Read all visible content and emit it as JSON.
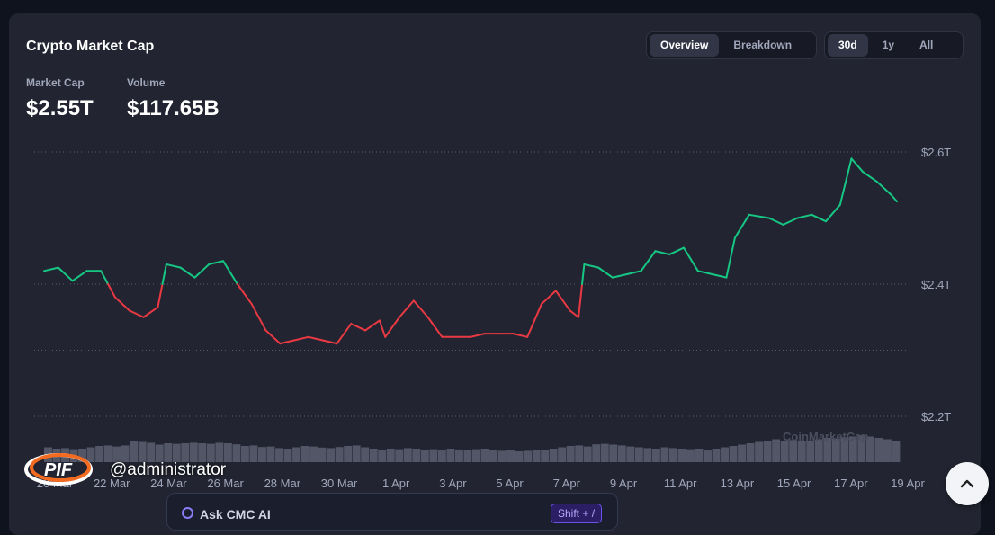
{
  "header": {
    "title": "Crypto Market Cap",
    "view_tabs": [
      {
        "label": "Overview",
        "active": true
      },
      {
        "label": "Breakdown",
        "active": false
      }
    ],
    "range_tabs": [
      {
        "label": "30d",
        "active": true
      },
      {
        "label": "1y",
        "active": false
      },
      {
        "label": "All",
        "active": false
      }
    ]
  },
  "metrics": {
    "market_cap_label": "Market Cap",
    "market_cap_value": "$2.55T",
    "volume_label": "Volume",
    "volume_value": "$117.65B"
  },
  "watermark": "CoinMarketCap",
  "ask": {
    "label": "Ask CMC AI",
    "shortcut": "Shift + /"
  },
  "overlay": {
    "user": "@administrator"
  },
  "colors": {
    "up": "#16c784",
    "down": "#ea3943",
    "grid": "#585d6e",
    "volume": "#5a5f70"
  },
  "chart_data": {
    "type": "line",
    "x_tick_labels": [
      "20 Mar",
      "22 Mar",
      "24 Mar",
      "26 Mar",
      "28 Mar",
      "30 Mar",
      "1 Apr",
      "3 Apr",
      "5 Apr",
      "7 Apr",
      "9 Apr",
      "11 Apr",
      "13 Apr",
      "15 Apr",
      "17 Apr",
      "19 Apr"
    ],
    "y_tick_labels": [
      "$2.6T",
      "$2.4T",
      "$2.2T"
    ],
    "y_ticks": [
      2.6,
      2.4,
      2.2
    ],
    "ylim": [
      2.2,
      2.6
    ],
    "xlim": [
      "20 Mar",
      "19 Apr"
    ],
    "baseline": 2.4,
    "series": [
      {
        "values_unit": "trillion USD",
        "points": [
          [
            "20 Mar",
            2.42
          ],
          [
            "20.5 Mar",
            2.425
          ],
          [
            "21 Mar",
            2.405
          ],
          [
            "21.5 Mar",
            2.42
          ],
          [
            "22 Mar",
            2.42
          ],
          [
            "22.5 Mar",
            2.38
          ],
          [
            "23 Mar",
            2.36
          ],
          [
            "23.5 Mar",
            2.35
          ],
          [
            "24 Mar",
            2.365
          ],
          [
            "24.3 Mar",
            2.43
          ],
          [
            "24.8 Mar",
            2.425
          ],
          [
            "25.3 Mar",
            2.41
          ],
          [
            "25.8 Mar",
            2.43
          ],
          [
            "26.3 Mar",
            2.435
          ],
          [
            "26.8 Mar",
            2.4
          ],
          [
            "27.3 Mar",
            2.37
          ],
          [
            "27.8 Mar",
            2.33
          ],
          [
            "28.3 Mar",
            2.31
          ],
          [
            "28.8 Mar",
            2.315
          ],
          [
            "29.3 Mar",
            2.32
          ],
          [
            "29.8 Mar",
            2.315
          ],
          [
            "30.3 Mar",
            2.31
          ],
          [
            "30.8 Mar",
            2.34
          ],
          [
            "31.3 Mar",
            2.33
          ],
          [
            "31.8 Mar",
            2.345
          ],
          [
            "1 Apr",
            2.32
          ],
          [
            "1.5 Apr",
            2.35
          ],
          [
            "2 Apr",
            2.375
          ],
          [
            "2.5 Apr",
            2.35
          ],
          [
            "3 Apr",
            2.32
          ],
          [
            "3.5 Apr",
            2.32
          ],
          [
            "4 Apr",
            2.32
          ],
          [
            "4.5 Apr",
            2.325
          ],
          [
            "5 Apr",
            2.325
          ],
          [
            "5.5 Apr",
            2.325
          ],
          [
            "6 Apr",
            2.32
          ],
          [
            "6.5 Apr",
            2.37
          ],
          [
            "7 Apr",
            2.39
          ],
          [
            "7.5 Apr",
            2.36
          ],
          [
            "7.8 Apr",
            2.35
          ],
          [
            "8 Apr",
            2.43
          ],
          [
            "8.5 Apr",
            2.425
          ],
          [
            "9 Apr",
            2.41
          ],
          [
            "9.5 Apr",
            2.415
          ],
          [
            "10 Apr",
            2.42
          ],
          [
            "10.5 Apr",
            2.45
          ],
          [
            "11 Apr",
            2.445
          ],
          [
            "11.5 Apr",
            2.455
          ],
          [
            "12 Apr",
            2.42
          ],
          [
            "12.5 Apr",
            2.415
          ],
          [
            "13 Apr",
            2.41
          ],
          [
            "13.3 Apr",
            2.47
          ],
          [
            "13.8 Apr",
            2.505
          ],
          [
            "14.5 Apr",
            2.5
          ],
          [
            "15 Apr",
            2.49
          ],
          [
            "15.5 Apr",
            2.5
          ],
          [
            "16 Apr",
            2.505
          ],
          [
            "16.5 Apr",
            2.495
          ],
          [
            "17 Apr",
            2.52
          ],
          [
            "17.4 Apr",
            2.59
          ],
          [
            "17.8 Apr",
            2.57
          ],
          [
            "18.3 Apr",
            2.555
          ],
          [
            "18.8 Apr",
            2.535
          ],
          [
            "19 Apr",
            2.525
          ]
        ]
      }
    ],
    "volume_series": [
      0.55,
      0.5,
      0.52,
      0.48,
      0.5,
      0.55,
      0.6,
      0.62,
      0.58,
      0.62,
      0.8,
      0.75,
      0.72,
      0.65,
      0.7,
      0.68,
      0.7,
      0.72,
      0.7,
      0.68,
      0.72,
      0.7,
      0.66,
      0.6,
      0.62,
      0.56,
      0.58,
      0.52,
      0.5,
      0.55,
      0.6,
      0.58,
      0.54,
      0.52,
      0.56,
      0.6,
      0.62,
      0.55,
      0.5,
      0.45,
      0.5,
      0.48,
      0.52,
      0.5,
      0.46,
      0.48,
      0.45,
      0.5,
      0.47,
      0.44,
      0.48,
      0.5,
      0.46,
      0.42,
      0.44,
      0.4,
      0.42,
      0.44,
      0.46,
      0.5,
      0.55,
      0.6,
      0.62,
      0.58,
      0.66,
      0.68,
      0.65,
      0.62,
      0.58,
      0.55,
      0.52,
      0.5,
      0.55,
      0.52,
      0.5,
      0.48,
      0.5,
      0.45,
      0.5,
      0.55,
      0.6,
      0.65,
      0.7,
      0.75,
      0.8,
      0.85,
      0.8,
      0.82,
      0.78,
      0.8,
      0.85,
      0.9,
      0.88,
      0.92,
      0.95,
      1.0,
      0.95,
      0.9,
      0.85,
      0.8
    ]
  }
}
